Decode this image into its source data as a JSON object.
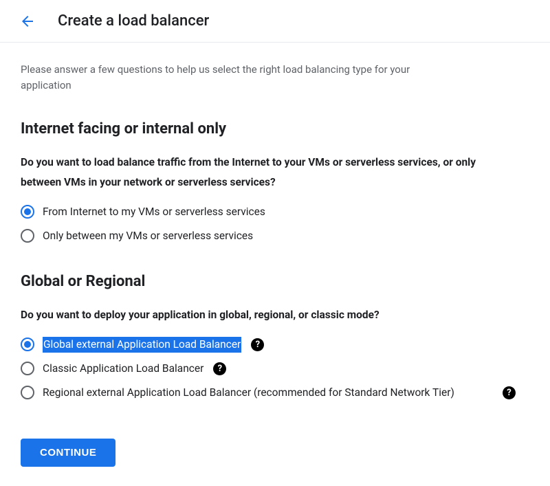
{
  "header": {
    "title": "Create a load balancer"
  },
  "description": "Please answer a few questions to help us select the right load balancing type for your application",
  "section1": {
    "title": "Internet facing or internal only",
    "question": "Do you want to load balance traffic from the Internet to your VMs or serverless services, or only between VMs in your network or serverless services?",
    "options": [
      {
        "label": "From Internet to my VMs or serverless services",
        "selected": true
      },
      {
        "label": "Only between my VMs or serverless services",
        "selected": false
      }
    ]
  },
  "section2": {
    "title": "Global or Regional",
    "question": "Do you want to deploy your application in global, regional, or classic mode?",
    "options": [
      {
        "label": "Global external Application Load Balancer",
        "selected": true,
        "highlighted": true
      },
      {
        "label": "Classic Application Load Balancer",
        "selected": false
      },
      {
        "label": "Regional external Application Load Balancer (recommended for Standard Network Tier)",
        "selected": false
      }
    ]
  },
  "continueLabel": "Continue"
}
